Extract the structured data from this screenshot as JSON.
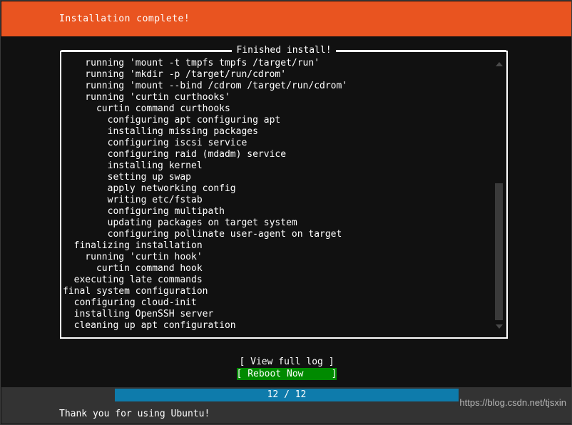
{
  "header": {
    "title": "Installation complete!"
  },
  "log_box": {
    "title": "Finished install!",
    "lines": [
      "    running 'mount -t tmpfs tmpfs /target/run'",
      "    running 'mkdir -p /target/run/cdrom'",
      "    running 'mount --bind /cdrom /target/run/cdrom'",
      "    running 'curtin curthooks'",
      "      curtin command curthooks",
      "        configuring apt configuring apt",
      "        installing missing packages",
      "        configuring iscsi service",
      "        configuring raid (mdadm) service",
      "        installing kernel",
      "        setting up swap",
      "        apply networking config",
      "        writing etc/fstab",
      "        configuring multipath",
      "        updating packages on target system",
      "        configuring pollinate user-agent on target",
      "  finalizing installation",
      "    running 'curtin hook'",
      "      curtin command hook",
      "  executing late commands",
      "final system configuration",
      "  configuring cloud-init",
      "  installing OpenSSH server",
      "  cleaning up apt configuration"
    ],
    "scrollbar": {
      "up_arrow": "scroll-up-arrow",
      "down_arrow": "scroll-down-arrow",
      "thumb_top_percent": 45,
      "thumb_height_percent": 55
    }
  },
  "buttons": [
    {
      "label": "[ View full log ]",
      "selected": false,
      "name": "view-full-log-button"
    },
    {
      "label": "[ Reboot Now     ]",
      "selected": true,
      "name": "reboot-now-button"
    }
  ],
  "footer": {
    "progress": {
      "label": "12 / 12",
      "current": 12,
      "total": 12,
      "percent": 100
    },
    "note": "Thank you for using Ubuntu!",
    "watermark": "https://blog.csdn.net/tjsxin"
  },
  "colors": {
    "accent_orange": "#e95420",
    "progress_blue": "#0e7bab",
    "selected_green": "#008a00",
    "terminal_bg": "#111111",
    "footer_bg": "#333333"
  }
}
